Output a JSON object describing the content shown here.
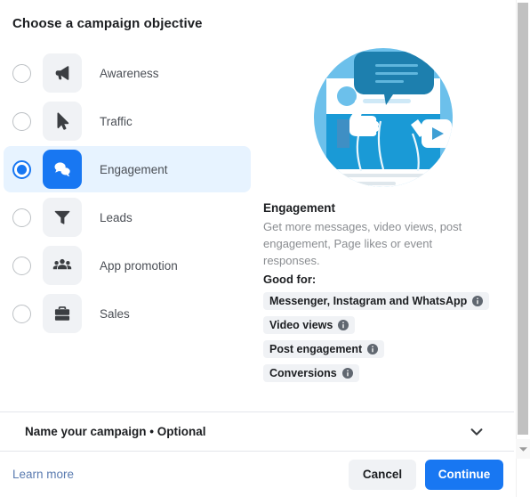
{
  "header": {
    "title": "Choose a campaign objective"
  },
  "objectives": [
    {
      "label": "Awareness",
      "icon": "megaphone-icon",
      "selected": false
    },
    {
      "label": "Traffic",
      "icon": "cursor-icon",
      "selected": false
    },
    {
      "label": "Engagement",
      "icon": "chat-bubbles-icon",
      "selected": true
    },
    {
      "label": "Leads",
      "icon": "funnel-icon",
      "selected": false
    },
    {
      "label": "App promotion",
      "icon": "people-icon",
      "selected": false
    },
    {
      "label": "Sales",
      "icon": "briefcase-icon",
      "selected": false
    }
  ],
  "detail": {
    "illustration": "engagement-illustration",
    "title": "Engagement",
    "description": "Get more messages, video views, post engagement, Page likes or event responses.",
    "good_for_label": "Good for:",
    "chips": [
      {
        "label": "Messenger, Instagram and WhatsApp",
        "icon": "info-icon"
      },
      {
        "label": "Video views",
        "icon": "info-icon"
      },
      {
        "label": "Post engagement",
        "icon": "info-icon"
      },
      {
        "label": "Conversions",
        "icon": "info-icon"
      }
    ]
  },
  "name_section": {
    "label": "Name your campaign • Optional",
    "chevron": "chevron-down-icon"
  },
  "footer": {
    "learn_more": "Learn more",
    "cancel": "Cancel",
    "continue": "Continue"
  },
  "colors": {
    "accent": "#1877f2",
    "selected_row": "#e7f3ff",
    "tile": "#f0f2f5",
    "text": "#1c1e21",
    "muted": "#8a8d91",
    "link": "#5a7bb0"
  }
}
